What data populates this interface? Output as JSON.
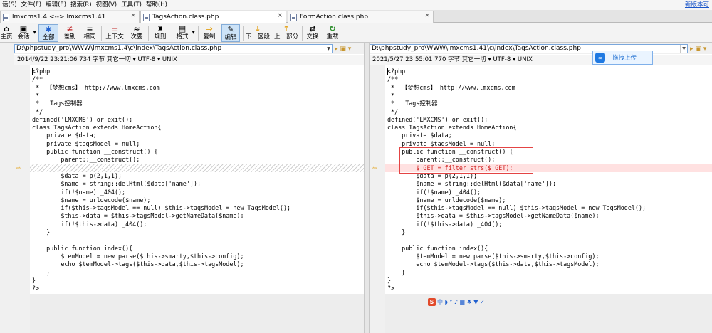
{
  "menubar": {
    "items": [
      "话(S)",
      "文件(F)",
      "编辑(E)",
      "搜索(R)",
      "视图(V)",
      "工具(T)",
      "帮助(H)"
    ],
    "update_link": "新版本可"
  },
  "tabs": [
    {
      "label": "lmxcms1.4 <--> lmxcms1.41"
    },
    {
      "label": "TagsAction.class.php"
    },
    {
      "label": "FormAction.class.php"
    }
  ],
  "toolbar": {
    "buttons": [
      {
        "glyph": "⌂",
        "label": "主页"
      },
      {
        "glyph": "▣",
        "label": "会话"
      },
      {
        "glyph": "✱",
        "label": "全部"
      },
      {
        "glyph": "≠",
        "label": "差别"
      },
      {
        "glyph": "=",
        "label": "相同"
      },
      {
        "glyph": "☰",
        "label": "上下文"
      },
      {
        "glyph": "≈",
        "label": "次要"
      },
      {
        "glyph": "♜",
        "label": "规则"
      },
      {
        "glyph": "▤",
        "label": "格式"
      },
      {
        "glyph": "⇒",
        "label": "复制"
      },
      {
        "glyph": "✎",
        "label": "编辑"
      },
      {
        "glyph": "↓",
        "label": "下一区段"
      },
      {
        "glyph": "↑",
        "label": "上一部分"
      },
      {
        "glyph": "⇄",
        "label": "交换"
      },
      {
        "glyph": "↻",
        "label": "重载"
      }
    ]
  },
  "left_pane": {
    "path": "D:\\phpstudy_pro\\WWW\\lmxcms1.4\\c\\index\\TagsAction.class.php",
    "info": "2014/9/22 23:21:06   734 字节   其它一切 ▾  UTF-8 ▾  UNIX",
    "lines": [
      "<?php",
      "/**",
      " *  【梦想cms】 http://www.lmxcms.com",
      " *",
      " *   Tags控制器",
      " */",
      "defined('LMXCMS') or exit();",
      "class TagsAction extends HomeAction{",
      "    private $data;",
      "    private $tagsModel = null;",
      "    public function __construct() {",
      "        parent::__construct();",
      "",
      "        $data = p(2,1,1);",
      "        $name = string::delHtml($data['name']);",
      "        if(!$name) _404();",
      "        $name = urldecode($name);",
      "        if($this->tagsModel == null) $this->tagsModel = new TagsModel();",
      "        $this->data = $this->tagsModel->getNameData($name);",
      "        if(!$this->data) _404();",
      "    }",
      "",
      "    public function index(){",
      "        $temModel = new parse($this->smarty,$this->config);",
      "        echo $temModel->tags($this->data,$this->tagsModel);",
      "    }",
      "}",
      "?>"
    ]
  },
  "right_pane": {
    "path": "D:\\phpstudy_pro\\WWW\\lmxcms1.41\\c\\index\\TagsAction.class.php",
    "info": "2021/5/27 23:55:01   770 字节   其它一切 ▾  UTF-8 ▾  UNIX",
    "lines": [
      "<?php",
      "/**",
      " *  【梦想cms】 http://www.lmxcms.com",
      " *",
      " *   Tags控制器",
      " */",
      "defined('LMXCMS') or exit();",
      "class TagsAction extends HomeAction{",
      "    private $data;",
      "    private $tagsModel = null;",
      "    public function __construct() {",
      "        parent::__construct();",
      "        $_GET = filter_strs($_GET);",
      "        $data = p(2,1,1);",
      "        $name = string::delHtml($data['name']);",
      "        if(!$name) _404();",
      "        $name = urldecode($name);",
      "        if($this->tagsModel == null) $this->tagsModel = new TagsModel();",
      "        $this->data = $this->tagsModel->getNameData($name);",
      "        if(!$this->data) _404();",
      "    }",
      "",
      "    public function index(){",
      "        $temModel = new parse($this->smarty,$this->config);",
      "        echo $temModel->tags($this->data,$this->tagsModel);",
      "    }",
      "}",
      "?>"
    ]
  },
  "diff_marker_glyph": "⇨",
  "diff_marker_glyph_right": "⇦",
  "drag_upload_label": "拖拽上传",
  "ime_toolbar": {
    "logo": "S",
    "items": "中 ◗ ° ♪ ▦ ♣ ▼ ✓"
  },
  "colors": {
    "diff_highlight": "#ffe1e1",
    "accent_blue": "#1f79e2",
    "red_box": "#e44444"
  }
}
